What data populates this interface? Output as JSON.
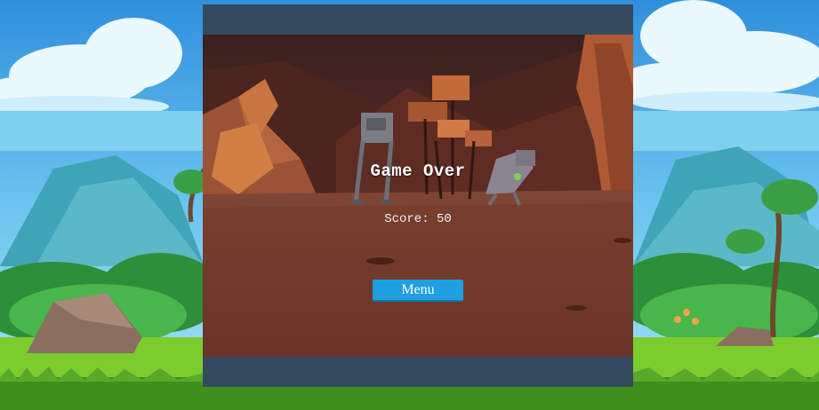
{
  "game_over": {
    "title": "Game Over",
    "score_text": "Score: 50",
    "menu_label": "Menu"
  },
  "colors": {
    "frame": "#34495e",
    "button": "#1f9fe0",
    "sky": "#4fb0e6",
    "grass": "#7ccc2e"
  },
  "scene": {
    "background": "cartoon-meadow-landscape",
    "game_background": "rocky-canyon-with-robots"
  }
}
